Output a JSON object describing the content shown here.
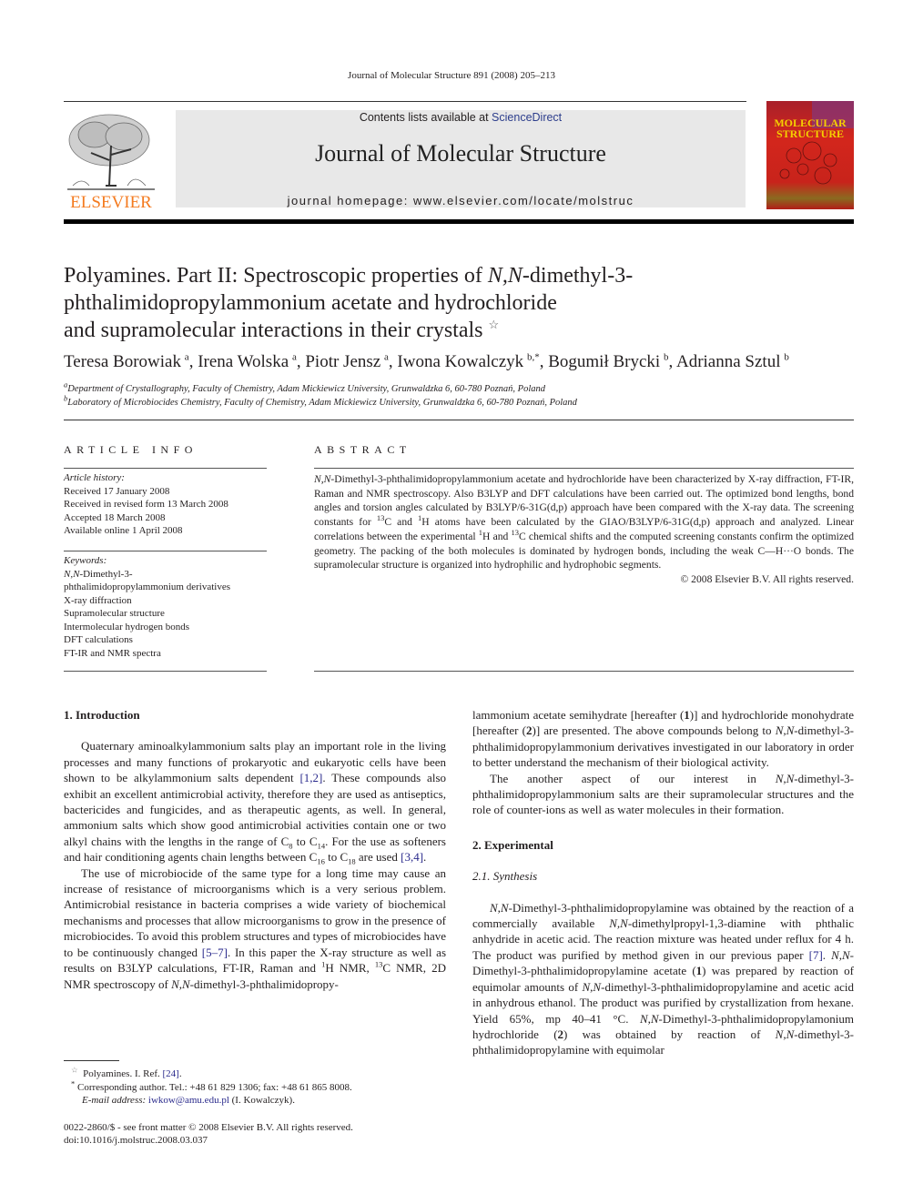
{
  "running_head": "Journal of Molecular Structure 891 (2008) 205–213",
  "banner": {
    "contents_prefix": "Contents lists available at ",
    "contents_link": "ScienceDirect",
    "journal_title": "Journal of Molecular Structure",
    "homepage_label": "journal homepage: ",
    "homepage_url": "www.elsevier.com/locate/molstruc"
  },
  "publisher_logo": {
    "text": "ELSEVIER",
    "color": "#f47b20"
  },
  "cover": {
    "line1": "MOLECULAR",
    "line2": "STRUCTURE",
    "text_color": "#f5d000",
    "bg_color": "#c8231b"
  },
  "article": {
    "title_line1_a": "Polyamines. Part II: Spectroscopic properties of ",
    "title_line1_it": "N,N",
    "title_line1_b": "-dimethyl-3-",
    "title_line2": "phthalimidopropylammonium acetate and hydrochloride",
    "title_line3": "and supramolecular interactions in their crystals",
    "title_mark": "☆",
    "authors": [
      {
        "name": "Teresa Borowiak",
        "aff": "a"
      },
      {
        "name": "Irena Wolska",
        "aff": "a"
      },
      {
        "name": "Piotr Jensz",
        "aff": "a"
      },
      {
        "name": "Iwona Kowalczyk",
        "aff": "b,*"
      },
      {
        "name": "Bogumił Brycki",
        "aff": "b"
      },
      {
        "name": "Adrianna Sztul",
        "aff": "b"
      }
    ],
    "affiliations": [
      {
        "mark": "a",
        "text": "Department of Crystallography, Faculty of Chemistry, Adam Mickiewicz University, Grunwaldzka 6, 60-780 Poznań, Poland"
      },
      {
        "mark": "b",
        "text": "Laboratory of Microbiocides Chemistry, Faculty of Chemistry, Adam Mickiewicz University, Grunwaldzka 6, 60-780 Poznań, Poland"
      }
    ]
  },
  "article_info": {
    "heading": "ARTICLE INFO",
    "history_label": "Article history:",
    "history": [
      "Received 17 January 2008",
      "Received in revised form 13 March 2008",
      "Accepted 18 March 2008",
      "Available online 1 April 2008"
    ],
    "keywords_label": "Keywords:",
    "keyword_first_it": "N,N",
    "keyword_first_rest": "-Dimethyl-3-",
    "keyword_first_line2": "phthalimidopropylammonium derivatives",
    "keywords": [
      "X-ray diffraction",
      "Supramolecular structure",
      "Intermolecular hydrogen bonds",
      "DFT calculations",
      "FT-IR and NMR spectra"
    ]
  },
  "abstract": {
    "heading": "ABSTRACT",
    "p_it": "N,N",
    "p1": "-Dimethyl-3-phthalimidopropylammonium acetate and hydrochloride have been characterized by X-ray diffraction, FT-IR, Raman and NMR spectroscopy. Also B3LYP and DFT calculations have been carried out. The optimized bond lengths, bond angles and torsion angles calculated by B3LYP/6-31G(d,p) approach have been compared with the X-ray data. The screening constants for ",
    "sup13": "13",
    "p2": "C and ",
    "sup1": "1",
    "p3": "H atoms have been calculated by the GIAO/B3LYP/6-31G(d,p) approach and analyzed. Linear correlations between the experimental ",
    "p4": "H and ",
    "p5": "C chemical shifts and the computed screening constants confirm the optimized geometry. The packing of the both molecules is dominated by hydrogen bonds, including the weak C—H···O bonds. The supramolecular structure is organized into hydrophilic and hydrophobic segments.",
    "copyright": "© 2008 Elsevier B.V. All rights reserved."
  },
  "body": {
    "s1_heading": "1.  Introduction",
    "intro_p1_a": "Quaternary aminoalkylammonium salts play an important role in the living processes and many functions of prokaryotic and eukaryotic cells have been shown to be alkylammonium salts dependent ",
    "ref_1_2": "[1,2]",
    "intro_p1_b": ". These compounds also exhibit an excellent antimicrobial activity, therefore they are used as antiseptics, bactericides and fungicides, and as therapeutic agents, as well. In general, ammonium salts which show good antimicrobial activities contain one or two alkyl chains with the lengths in the range of C",
    "sub8": "8",
    "intro_p1_c": " to C",
    "sub14": "14",
    "intro_p1_d": ". For the use as softeners and hair conditioning agents chain lengths between C",
    "sub16": "16",
    "intro_p1_e": " to C",
    "sub18": "18",
    "intro_p1_f": " are used ",
    "ref_3_4": "[3,4]",
    "intro_p2_a": "The use of microbiocide of the same type for a long time may cause an increase of resistance of microorganisms which is a very serious problem. Antimicrobial resistance in bacteria comprises a wide variety of biochemical mechanisms and processes that allow microorganisms to grow in the presence of microbiocides. To avoid this problem structures and types of microbiocides have to be continuously changed ",
    "ref_5_7": "[5–7]",
    "intro_p2_b": ". In this paper the X-ray structure as well as results on B3LYP calculations, FT-IR, Raman and ",
    "sup1": "1",
    "intro_p2_c": "H NMR, ",
    "sup13": "13",
    "intro_p2_d": "C NMR, 2D NMR spectroscopy of ",
    "nn": "N,N",
    "intro_p2_e": "-dimethyl-3-phthalimidopropylammonium acetate semihydrate [hereafter (",
    "b1": "1",
    "intro_p2_f": ")] and hydrochloride monohydrate [hereafter (",
    "b2": "2",
    "intro_p2_g": ")] are presented. The above compounds belong to ",
    "intro_p2_h": "-dimethyl-3-phthalimidopropylammonium derivatives investigated in our laboratory in order to better understand the mechanism of their biological activity.",
    "intro_p3_a": "The another aspect of our interest in ",
    "intro_p3_b": "-dimethyl-3-phthalimidopropylammonium salts are their supramolecular structures and the role of counter-ions as well as water molecules in their formation.",
    "s2_heading": "2.  Experimental",
    "s21_heading": "2.1.  Synthesis",
    "syn_a": "-Dimethyl-3-phthalimidopropylamine was obtained by the reaction of a commercially available ",
    "syn_b": "-dimethylpropyl-1,3-diamine with phthalic anhydride in acetic acid. The reaction mixture was heated under reflux for 4 h. The product was purified by method given in our previous paper ",
    "ref_7": "[7]",
    "syn_c": ". ",
    "syn_d": "-Dimethyl-3-phthalimidopropylamine acetate (",
    "syn_e": ") was prepared by reaction of equimolar amounts of ",
    "syn_f": "-dimethyl-3-phthalimidopropylamine and acetic acid in anhydrous ethanol. The product was purified by crystallization from hexane. Yield 65%, mp 40–41 °C. ",
    "syn_g": "-Dimethyl-3-phthalimidopropylamonium hydrochloride (",
    "syn_h": ") was obtained by reaction of ",
    "syn_i": "-dimethyl-3-phthalimidopropylamine with equimolar"
  },
  "footnotes": {
    "star_mark": "☆",
    "star_text": "Polyamines. I. Ref. ",
    "star_ref": "[24]",
    "corr_mark": "*",
    "corr_text": "Corresponding author. Tel.: +48 61 829 1306; fax: +48 61 865 8008.",
    "email_label": "E-mail address: ",
    "email": "iwkow@amu.edu.pl",
    "email_name": " (I. Kowalczyk)."
  },
  "bottom": {
    "issn": "0022-2860/$ - see front matter © 2008 Elsevier B.V. All rights reserved.",
    "doi": "doi:10.1016/j.molstruc.2008.03.037"
  }
}
